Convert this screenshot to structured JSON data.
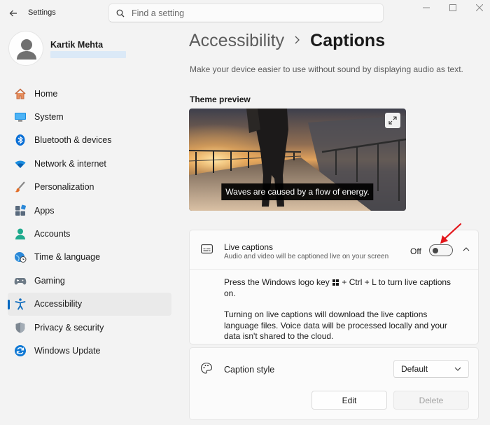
{
  "window": {
    "app_title": "Settings",
    "search_placeholder": "Find a setting"
  },
  "profile": {
    "name": "Kartik Mehta"
  },
  "nav": {
    "items": [
      {
        "label": "Home",
        "icon": "home-icon"
      },
      {
        "label": "System",
        "icon": "system-icon"
      },
      {
        "label": "Bluetooth & devices",
        "icon": "bluetooth-icon"
      },
      {
        "label": "Network & internet",
        "icon": "wifi-icon"
      },
      {
        "label": "Personalization",
        "icon": "brush-icon"
      },
      {
        "label": "Apps",
        "icon": "apps-icon"
      },
      {
        "label": "Accounts",
        "icon": "account-icon"
      },
      {
        "label": "Time & language",
        "icon": "globe-clock-icon"
      },
      {
        "label": "Gaming",
        "icon": "gamepad-icon"
      },
      {
        "label": "Accessibility",
        "icon": "accessibility-icon",
        "active": true
      },
      {
        "label": "Privacy & security",
        "icon": "shield-icon"
      },
      {
        "label": "Windows Update",
        "icon": "update-icon"
      }
    ]
  },
  "page": {
    "breadcrumb_parent": "Accessibility",
    "breadcrumb_current": "Captions",
    "subtitle": "Make your device easier to use without sound by displaying audio as text.",
    "preview_label": "Theme preview",
    "preview_caption": "Waves are caused by a flow of energy."
  },
  "live_captions": {
    "title": "Live captions",
    "description": "Audio and video will be captioned live on your screen",
    "state_label": "Off",
    "enabled": false,
    "body_line1_pre": "Press the Windows logo key",
    "body_line1_post": "+ Ctrl + L to turn live captions on.",
    "body_paragraph2": "Turning on live captions will download the live captions language files. Voice data will be processed locally and your data isn't shared to the cloud."
  },
  "caption_style": {
    "title": "Caption style",
    "selected": "Default",
    "edit_label": "Edit",
    "delete_label": "Delete"
  },
  "colors": {
    "accent": "#0067c0",
    "annotation_arrow": "#e3161b"
  }
}
